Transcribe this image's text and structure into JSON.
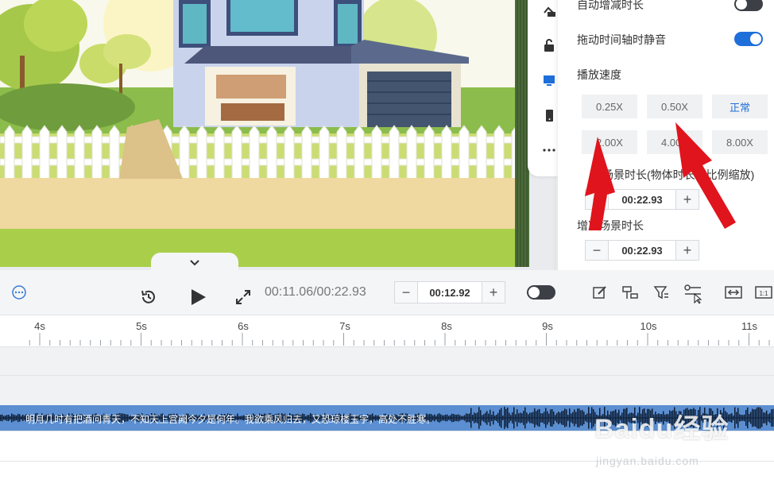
{
  "settings_panel": {
    "auto_duration_label": "自动增减时长",
    "auto_duration_on": false,
    "mute_label": "拖动时间轴时静音",
    "mute_on": true,
    "speed_label": "播放速度",
    "speeds": [
      "0.25X",
      "0.50X",
      "正常",
      "2.00X",
      "4.00X",
      "8.00X"
    ],
    "active_speed": "正常",
    "scene_duration_label": "场景时长(物体时长等比例缩放)",
    "scene_duration_value": "00:22.93",
    "adjust_scene_label": "增减场景时长",
    "adjust_scene_value": "00:22.93"
  },
  "controls": {
    "time_readout": "00:11.06/00:22.93",
    "stepper_value": "00:12.92",
    "toggle_on": false
  },
  "timeline": {
    "ticks": [
      "4s",
      "5s",
      "6s",
      "7s",
      "8s",
      "9s",
      "10s",
      "11s"
    ],
    "lyrics": "明月几时有把酒问青天，不知天上宫阙今夕是何年。我欲乘风归去，又恐琼楼玉宇，高处不胜寒。"
  },
  "watermark": {
    "brand": "Baidu经验",
    "url": "jingyan.baidu.com"
  },
  "colors": {
    "accent": "#1e6fd9",
    "audio_track": "#5b8fd1",
    "annotation_arrow": "#e0141c"
  }
}
